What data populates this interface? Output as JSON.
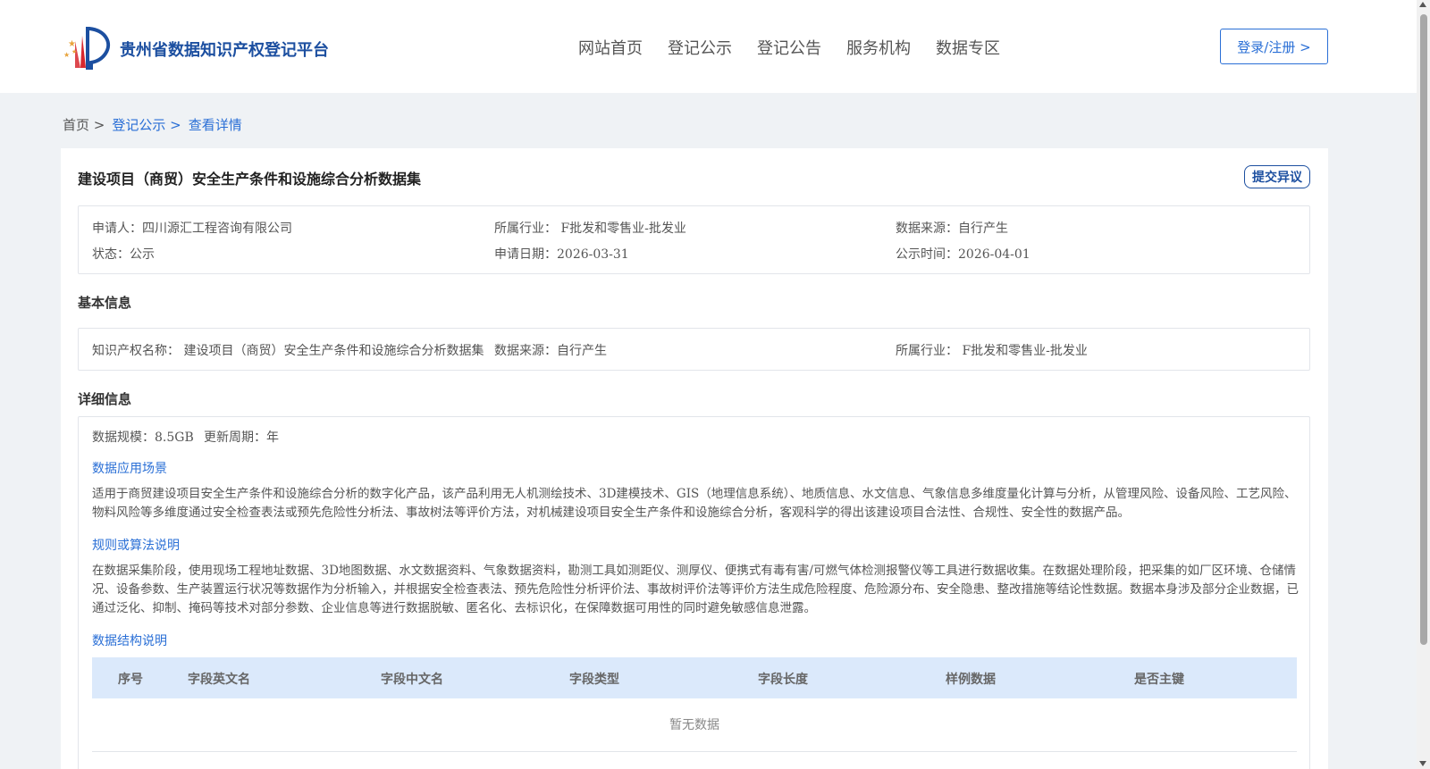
{
  "header": {
    "logo_text": "贵州省数据知识产权登记平台",
    "nav": [
      "网站首页",
      "登记公示",
      "登记公告",
      "服务机构",
      "数据专区"
    ],
    "login_label": "登录/注册 >"
  },
  "breadcrumb": {
    "home": "首页 >",
    "link1": "登记公示 >",
    "link2": "查看详情"
  },
  "detail": {
    "title": "建设项目（商贸）安全生产条件和设施综合分析数据集",
    "objection_label": "提交异议",
    "summary": {
      "applicant": "申请人：四川源汇工程咨询有限公司",
      "industry": "所属行业： F批发和零售业-批发业",
      "source": "数据来源：自行产生",
      "status": "状态：公示",
      "apply_date": "申请日期：2026-03-31",
      "publish_date": "公示时间：2026-04-01"
    },
    "basic_title": "基本信息",
    "basic": {
      "ip_name": "知识产权名称： 建设项目（商贸）安全生产条件和设施综合分析数据集",
      "source": "数据来源：自行产生",
      "industry": "所属行业： F批发和零售业-批发业"
    },
    "detail_title": "详细信息",
    "scale": "数据规模：8.5GB",
    "cycle": "更新周期：年",
    "scenario_title": "数据应用场景",
    "scenario_text": "适用于商贸建设项目安全生产条件和设施综合分析的数字化产品，该产品利用无人机测绘技术、3D建模技术、GIS（地理信息系统）、地质信息、水文信息、气象信息多维度量化计算与分析，从管理风险、设备风险、工艺风险、物料风险等多维度通过安全检查表法或预先危险性分析法、事故树法等评价方法，对机械建设项目安全生产条件和设施综合分析，客观科学的得出该建设项目合法性、合规性、安全性的数据产品。",
    "rules_title": "规则或算法说明",
    "rules_text": "在数据采集阶段，使用现场工程地址数据、3D地图数据、水文数据资料、气象数据资料，勘测工具如测距仪、测厚仪、便携式有毒有害/可燃气体检测报警仪等工具进行数据收集。在数据处理阶段，把采集的如厂区环境、仓储情况、设备参数、生产装置运行状况等数据作为分析输入，并根据安全检查表法、预先危险性分析评价法、事故树评价法等评价方法生成危险程度、危险源分布、安全隐患、整改措施等结论性数据。数据本身涉及部分企业数据，已通过泛化、抑制、掩码等技术对部分参数、企业信息等进行数据脱敏、匿名化、去标识化，在保障数据可用性的同时避免敏感信息泄露。",
    "structure_title": "数据结构说明",
    "table_headers": [
      "序号",
      "字段英文名",
      "字段中文名",
      "字段类型",
      "字段长度",
      "样例数据",
      "是否主键"
    ],
    "empty_text": "暂无数据"
  }
}
